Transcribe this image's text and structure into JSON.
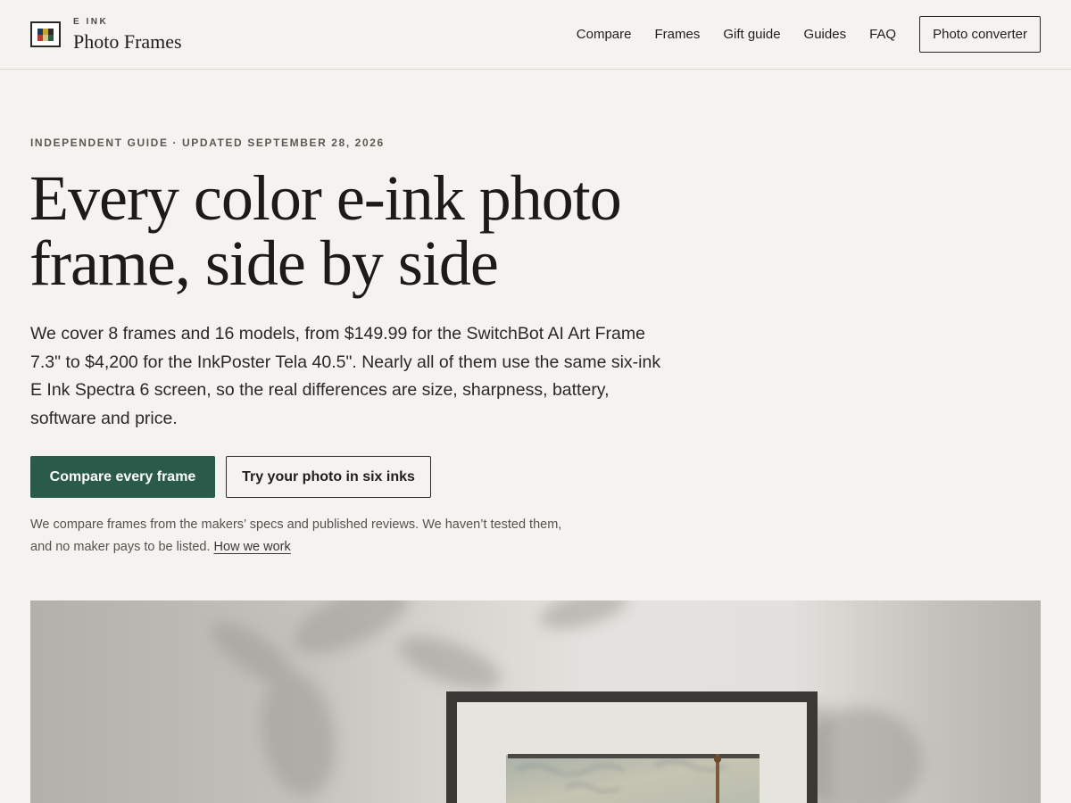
{
  "brand": {
    "kicker": "E INK",
    "title": "Photo Frames",
    "logo_icon": "framed-picture-icon"
  },
  "nav": {
    "items": [
      "Compare",
      "Frames",
      "Gift guide",
      "Guides",
      "FAQ"
    ],
    "cta": "Photo converter"
  },
  "hero": {
    "eyebrow": "INDEPENDENT GUIDE · UPDATED SEPTEMBER 28, 2026",
    "headline_line1": "Every color e-ink photo",
    "headline_line2": "frame, side by side",
    "lede": "We cover 8 frames and 16 models, from $149.99 for the SwitchBot AI Art Frame 7.3\" to $4,200 for the InkPoster Tela 40.5\". Nearly all of them use the same six-ink E Ink Spectra 6 screen, so the real differences are size, sharpness, battery, software and price.",
    "primary_button": "Compare every frame",
    "secondary_button": "Try your photo in six inks",
    "disclaimer": "We compare frames from the makers’ specs and published reviews. We haven’t tested them, and no maker pays to be listed.",
    "disclaimer_link": "How we work"
  },
  "colors": {
    "background": "#f4f3ef",
    "accent": "#295a4a",
    "text": "#1f1e1b"
  }
}
